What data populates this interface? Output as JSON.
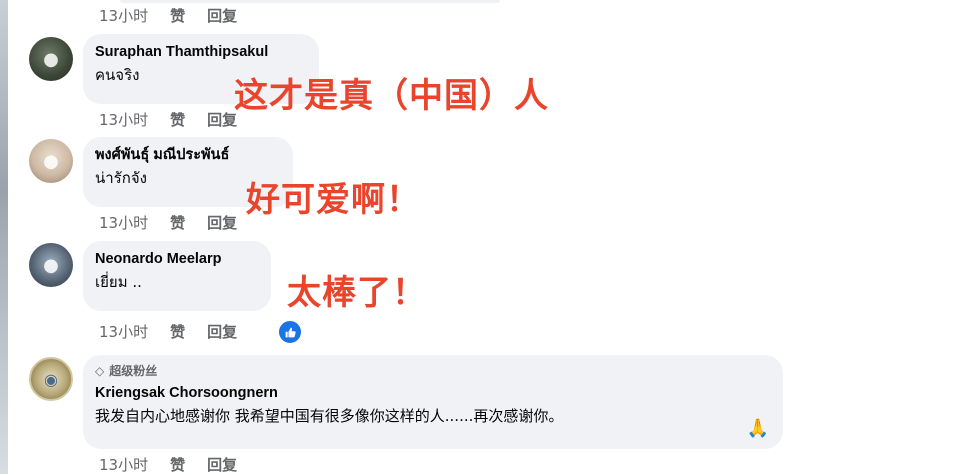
{
  "actions": {
    "like": "赞",
    "reply": "回复"
  },
  "comments": [
    {
      "time": "13小时"
    },
    {
      "author": "Suraphan Thamthipsakul",
      "text": "คนจริง",
      "time": "13小时",
      "overlay": "这才是真（中国）人"
    },
    {
      "author": "พงศ์พันธุ์ มณีประพันธ์",
      "text": "น่ารักจัง",
      "time": "13小时",
      "overlay": "好可爱啊！"
    },
    {
      "author": "Neonardo Meelarp",
      "text": "เยี่ยม ..",
      "time": "13小时",
      "overlay": "太棒了！",
      "reaction": "like-icon"
    },
    {
      "badge": "超级粉丝",
      "author": "Kriengsak Chorsoongnern",
      "text": "我发自内心地感谢你 我希望中国有很多像你这样的人......再次感谢你。",
      "time": "13小时"
    }
  ],
  "colors": {
    "bubble": "#f0f2f5",
    "meta_text": "#65676b",
    "overlay_red": "#e8452c",
    "like_blue": "#1b74e4"
  }
}
